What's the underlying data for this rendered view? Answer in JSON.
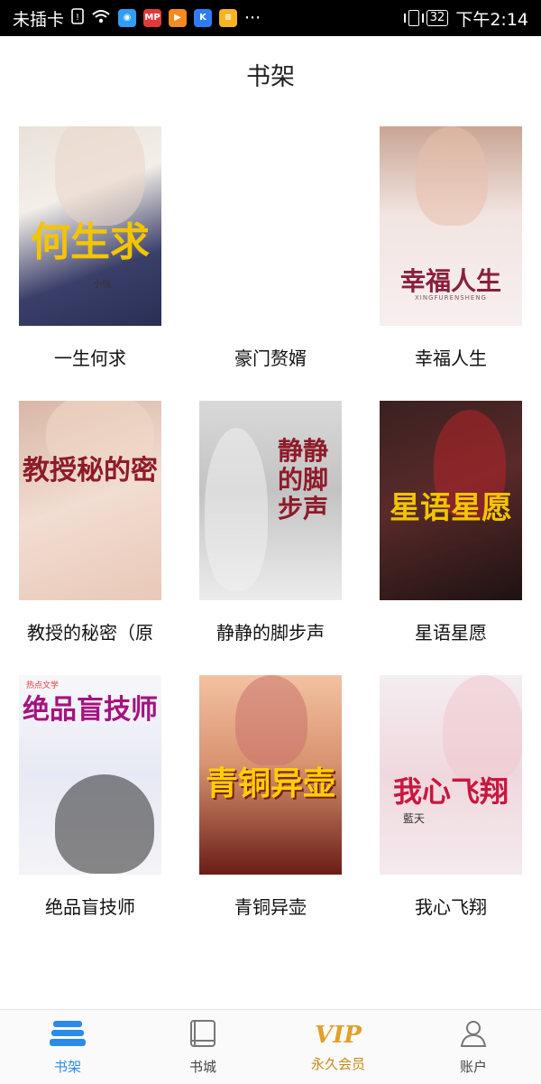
{
  "statusbar": {
    "carrier": "未插卡",
    "battery": "32",
    "time": "下午2:14",
    "more": "···",
    "app_icons": [
      "search-app",
      "mp-app",
      "video-app",
      "k-app",
      "note-app"
    ]
  },
  "header": {
    "title": "书架"
  },
  "books": [
    {
      "title": "一生何求",
      "cover_text": "何生求",
      "cover_author": "小强"
    },
    {
      "title": "豪门赘婿",
      "cover_text": ""
    },
    {
      "title": "幸福人生",
      "cover_text": "幸福人生",
      "cover_sub": "XINGFURENSHENG"
    },
    {
      "title": "教授的秘密（原",
      "cover_text": "教授秘的密"
    },
    {
      "title": "静静的脚步声",
      "cover_text": "静静的脚步声"
    },
    {
      "title": "星语星愿",
      "cover_text": "星语星愿"
    },
    {
      "title": "绝品盲技师",
      "cover_text": "绝品盲技师",
      "cover_brand": "热点文学"
    },
    {
      "title": "青铜异壶",
      "cover_text": "青铜异壶"
    },
    {
      "title": "我心飞翔",
      "cover_text": "我心飞翔",
      "cover_author": "藍天"
    }
  ],
  "nav": {
    "items": [
      {
        "label": "书架",
        "icon": "bookshelf-icon",
        "active": true
      },
      {
        "label": "书城",
        "icon": "book-icon",
        "active": false
      },
      {
        "label": "永久会员",
        "icon": "vip-icon",
        "active": false,
        "badge": "VIP"
      },
      {
        "label": "账户",
        "icon": "user-icon",
        "active": false
      }
    ]
  },
  "colors": {
    "accent": "#2b8be9",
    "vip": "#e2a028"
  }
}
